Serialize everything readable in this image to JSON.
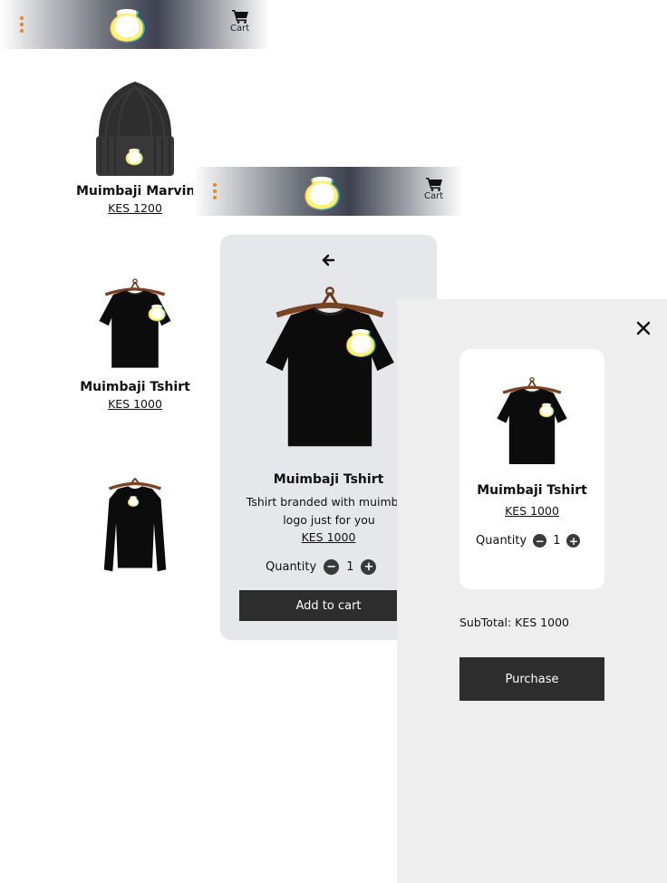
{
  "header": {
    "cart_label": "Cart"
  },
  "products": [
    {
      "name": "Muimbaji Marvin",
      "price": "KES 1200",
      "image": "beanie-image"
    },
    {
      "name": "Muimbaji Tshirt",
      "price": "KES 1000",
      "image": "tshirt-image"
    },
    {
      "name": "",
      "price": "",
      "image": "longsleeve-image"
    }
  ],
  "detail": {
    "name": "Muimbaji Tshirt",
    "description": "Tshirt branded with muimbaji logo just for you",
    "price": "KES 1000",
    "quantity_label": "Quantity",
    "quantity": "1",
    "add_to_cart_label": "Add to cart"
  },
  "cart": {
    "item": {
      "name": "Muimbaji Tshirt",
      "price": "KES 1000",
      "quantity_label": "Quantity",
      "quantity": "1"
    },
    "subtotal": "SubTotal: KES 1000",
    "purchase_label": "Purchase"
  },
  "colors": {
    "accent_menu": "#e8871e",
    "button_dark": "#2d2d2d",
    "card_bg": "#e6e7ea",
    "drawer_bg": "#eeeeee"
  }
}
